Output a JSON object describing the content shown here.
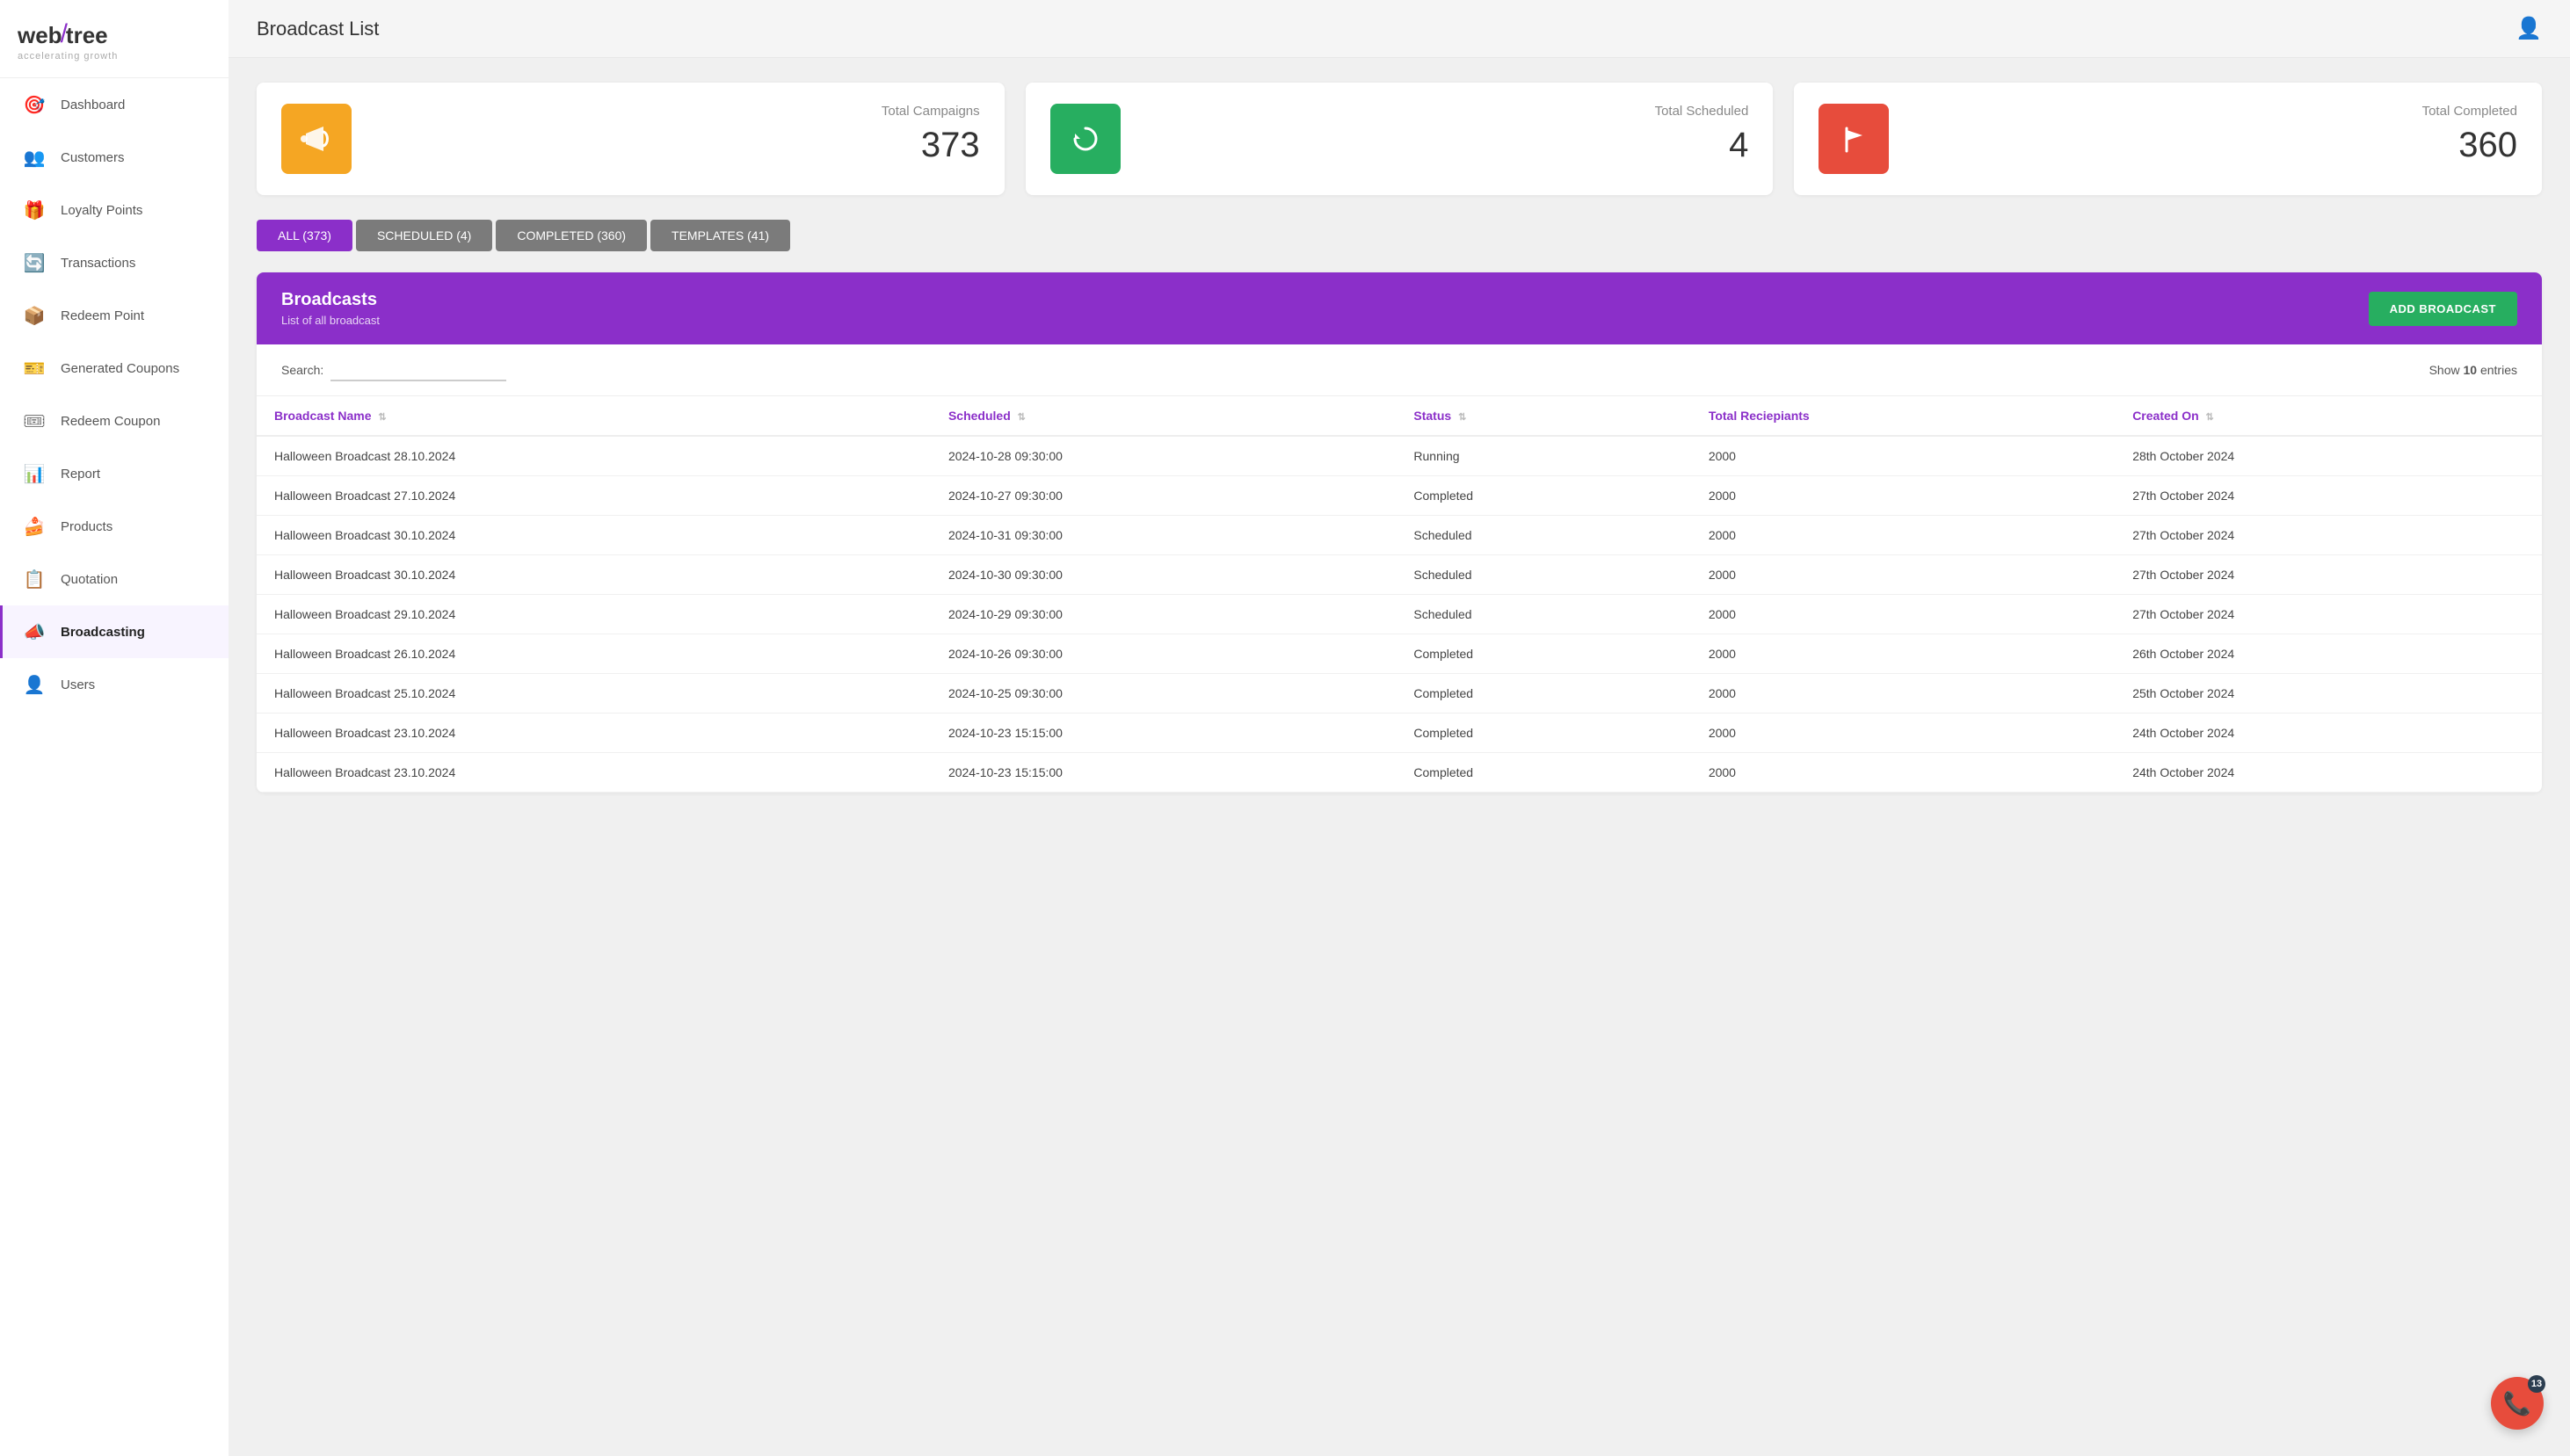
{
  "app": {
    "name": "webtree",
    "tagline": "accelerating growth"
  },
  "sidebar": {
    "items": [
      {
        "id": "dashboard",
        "label": "Dashboard",
        "icon": "🎯",
        "active": false
      },
      {
        "id": "customers",
        "label": "Customers",
        "icon": "👥",
        "active": false
      },
      {
        "id": "loyalty-points",
        "label": "Loyalty Points",
        "icon": "🎁",
        "active": false
      },
      {
        "id": "transactions",
        "label": "Transactions",
        "icon": "🔄",
        "active": false
      },
      {
        "id": "redeem-point",
        "label": "Redeem Point",
        "icon": "📦",
        "active": false
      },
      {
        "id": "generated-coupons",
        "label": "Generated Coupons",
        "icon": "🎫",
        "active": false
      },
      {
        "id": "redeem-coupon",
        "label": "Redeem Coupon",
        "icon": "🎟",
        "active": false
      },
      {
        "id": "report",
        "label": "Report",
        "icon": "📊",
        "active": false
      },
      {
        "id": "products",
        "label": "Products",
        "icon": "🍰",
        "active": false
      },
      {
        "id": "quotation",
        "label": "Quotation",
        "icon": "📋",
        "active": false
      },
      {
        "id": "broadcasting",
        "label": "Broadcasting",
        "icon": "📣",
        "active": true
      },
      {
        "id": "users",
        "label": "Users",
        "icon": "👤",
        "active": false
      }
    ]
  },
  "header": {
    "title": "Broadcast List",
    "user_icon": "👤"
  },
  "stats": [
    {
      "id": "total-campaigns",
      "label": "Total Campaigns",
      "value": "373",
      "icon": "📢",
      "color": "orange"
    },
    {
      "id": "total-scheduled",
      "label": "Total Scheduled",
      "value": "4",
      "icon": "🔄",
      "color": "green"
    },
    {
      "id": "total-completed",
      "label": "Total Completed",
      "value": "360",
      "icon": "🚩",
      "color": "red"
    }
  ],
  "filter_tabs": [
    {
      "id": "all",
      "label": "ALL (373)",
      "active": true
    },
    {
      "id": "scheduled",
      "label": "SCHEDULED (4)",
      "active": false
    },
    {
      "id": "completed",
      "label": "COMPLETED (360)",
      "active": false
    },
    {
      "id": "templates",
      "label": "TEMPLATES (41)",
      "active": false
    }
  ],
  "broadcasts": {
    "title": "Broadcasts",
    "subtitle": "List of all broadcast",
    "add_button": "ADD BROADCAST",
    "search_label": "Search:",
    "search_placeholder": "",
    "show_entries": "Show",
    "entries_count": "10",
    "entries_suffix": "entries",
    "columns": [
      {
        "id": "broadcast-name",
        "label": "Broadcast Name",
        "sortable": true
      },
      {
        "id": "scheduled",
        "label": "Scheduled",
        "sortable": true
      },
      {
        "id": "status",
        "label": "Status",
        "sortable": true
      },
      {
        "id": "total-recipients",
        "label": "Total Reciepiants",
        "sortable": false
      },
      {
        "id": "created-on",
        "label": "Created On",
        "sortable": true
      }
    ],
    "rows": [
      {
        "name": "Halloween Broadcast 28.10.2024",
        "scheduled": "2024-10-28 09:30:00",
        "status": "Running",
        "recipients": "2000",
        "created_on": "28th October 2024"
      },
      {
        "name": "Halloween Broadcast 27.10.2024",
        "scheduled": "2024-10-27 09:30:00",
        "status": "Completed",
        "recipients": "2000",
        "created_on": "27th October 2024"
      },
      {
        "name": "Halloween Broadcast 30.10.2024",
        "scheduled": "2024-10-31 09:30:00",
        "status": "Scheduled",
        "recipients": "2000",
        "created_on": "27th October 2024"
      },
      {
        "name": "Halloween Broadcast 30.10.2024",
        "scheduled": "2024-10-30 09:30:00",
        "status": "Scheduled",
        "recipients": "2000",
        "created_on": "27th October 2024"
      },
      {
        "name": "Halloween Broadcast 29.10.2024",
        "scheduled": "2024-10-29 09:30:00",
        "status": "Scheduled",
        "recipients": "2000",
        "created_on": "27th October 2024"
      },
      {
        "name": "Halloween Broadcast 26.10.2024",
        "scheduled": "2024-10-26 09:30:00",
        "status": "Completed",
        "recipients": "2000",
        "created_on": "26th October 2024"
      },
      {
        "name": "Halloween Broadcast 25.10.2024",
        "scheduled": "2024-10-25 09:30:00",
        "status": "Completed",
        "recipients": "2000",
        "created_on": "25th October 2024"
      },
      {
        "name": "Halloween Broadcast 23.10.2024",
        "scheduled": "2024-10-23 15:15:00",
        "status": "Completed",
        "recipients": "2000",
        "created_on": "24th October 2024"
      },
      {
        "name": "Halloween Broadcast 23.10.2024",
        "scheduled": "2024-10-23 15:15:00",
        "status": "Completed",
        "recipients": "2000",
        "created_on": "24th October 2024"
      }
    ]
  },
  "phone_fab": {
    "badge": "13"
  }
}
